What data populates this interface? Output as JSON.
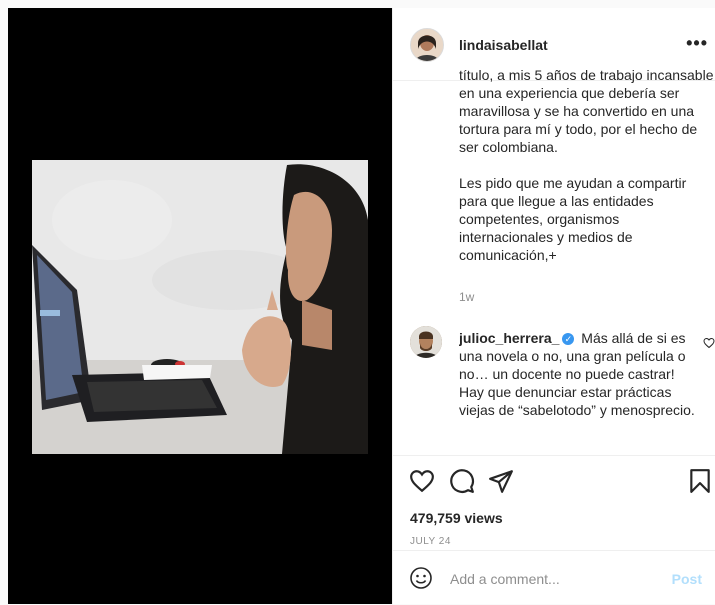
{
  "post": {
    "username": "lindaisabellat",
    "caption_text": "título, a mis 5 años de trabajo incansable en una experiencia que debería ser maravillosa y se ha convertido en una tortura para mí y todo, por el hecho de ser colombiana.\n\nLes pido que me ayudan a compartir para que llegue a las entidades competentes, organismos internacionales y medios de comunicación,+",
    "time_ago": "1w",
    "more_label": "•••"
  },
  "comment": {
    "username": "julioc_herrera_",
    "text": "Más allá de si es una novela o no, una gran película o no… un docente no puede castrar!\nHay que denunciar estar prácticas viejas de “sabelotodo” y menosprecio."
  },
  "stats": {
    "views": "479,759 views",
    "date": "JULY 24"
  },
  "composer": {
    "placeholder": "Add a comment...",
    "post_label": "Post"
  },
  "icons": [
    "more-options-icon",
    "verified-badge-icon",
    "heart-icon",
    "comment-icon",
    "share-icon",
    "save-bookmark-icon",
    "emoji-icon"
  ],
  "colors": {
    "accent": "#3897f0",
    "post_disabled": "#b2dffc",
    "muted": "#8e8e8e",
    "text": "#262626"
  }
}
